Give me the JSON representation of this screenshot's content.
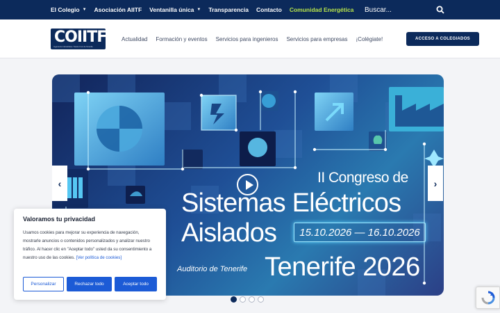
{
  "topbar": {
    "items": [
      {
        "label": "El Colegio",
        "has_dropdown": true
      },
      {
        "label": "Asociación AIITF",
        "has_dropdown": false
      },
      {
        "label": "Ventanilla única",
        "has_dropdown": true
      },
      {
        "label": "Transparencia",
        "has_dropdown": false
      },
      {
        "label": "Contacto",
        "has_dropdown": false
      },
      {
        "label": "Comunidad Energética",
        "has_dropdown": false
      }
    ],
    "search_placeholder": "Buscar..."
  },
  "logo": {
    "text": "COIITF",
    "subtitle": "Ingenieros Industriales / Santa Cruz de Tenerife"
  },
  "nav": {
    "items": [
      "Actualidad",
      "Formación y eventos",
      "Servicios para ingenieros",
      "Servicios para empresas",
      "¡Colégiate!"
    ],
    "login_label": "ACCESO A COLEGIADOS"
  },
  "slide": {
    "line1": "II Congreso de",
    "line2": "Sistemas Eléctricos",
    "line3": "Aislados",
    "dates": "15.10.2026 — 16.10.2026",
    "venue": "Auditorio de Tenerife",
    "year": "Tenerife 2026"
  },
  "slider": {
    "prev": "‹",
    "next": "›",
    "dots": 4,
    "active_dot": 0
  },
  "cookie": {
    "title": "Valoramos tu privacidad",
    "text": "Usamos cookies para mejorar su experiencia de navegación, mostrarle anuncios o contenidos personalizados y analizar nuestro tráfico. Al hacer clic en \"Aceptar todo\" usted da su consentimiento a nuestro uso de las cookies.",
    "policy": "[Ver política de cookies]",
    "btn_customize": "Personalizar",
    "btn_reject": "Rechazar todo",
    "btn_accept": "Aceptar todo"
  },
  "colors": {
    "navy": "#0c2a5b",
    "accent_green": "#b6e34a",
    "cookie_blue": "#1c5bd6"
  }
}
